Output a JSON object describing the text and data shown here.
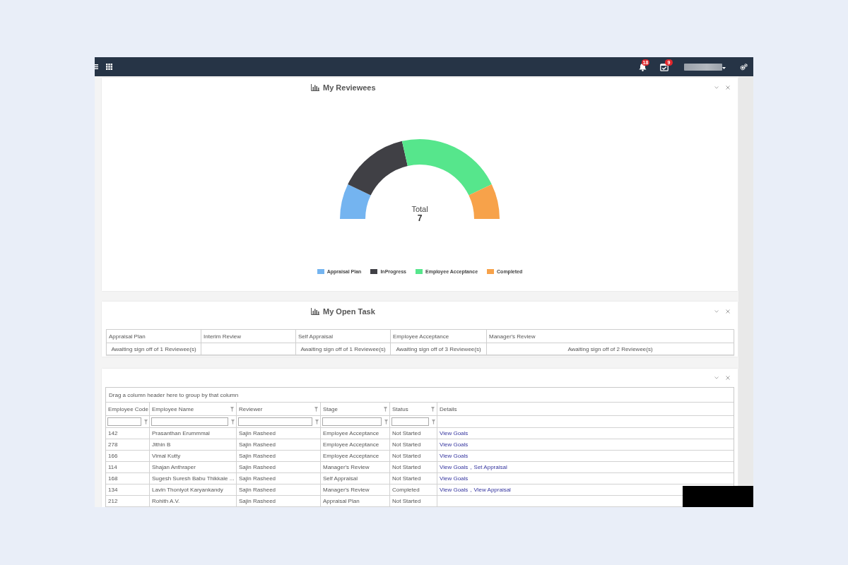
{
  "navbar": {
    "notifications": {
      "badge": "18"
    },
    "tasks": {
      "badge": "9"
    }
  },
  "reviewees": {
    "title": "My Reviewees",
    "center_label": "Total",
    "center_value": "7",
    "chart_data": {
      "type": "donut",
      "categories": [
        "Appraisal Plan",
        "InProgress",
        "Employee Acceptance",
        "Completed"
      ],
      "values": [
        14.29,
        28.57,
        42.85,
        14.29
      ],
      "colors": [
        "#74b4f0",
        "#404045",
        "#56e68c",
        "#f7a24a"
      ]
    }
  },
  "open_task": {
    "title": "My Open Task",
    "columns": [
      {
        "header": "Appraisal Plan",
        "value": "Awaiting sign off of 1 Reviewee(s)"
      },
      {
        "header": "Interim Review"
      },
      {
        "header": "Self Appraisal",
        "value": "Awaiting sign off of 1 Reviewee(s)"
      },
      {
        "header": "Employee Acceptance",
        "value": "Awaiting sign off of 3 Reviewee(s)"
      },
      {
        "header": "Manager's Review",
        "value": "Awaiting sign off of 2 Reviewee(s)"
      }
    ]
  },
  "employee_grid": {
    "group_hint": "Drag a column header here to group by that column",
    "details_separator": ",",
    "columns": [
      {
        "label": "Employee Code",
        "header_funnel": false,
        "filter_field": true
      },
      {
        "label": "Employee Name",
        "header_funnel": true,
        "filter_field": true
      },
      {
        "label": "Reviewer",
        "header_funnel": true,
        "filter_field": true
      },
      {
        "label": "Stage",
        "header_funnel": true,
        "filter_field": true
      },
      {
        "label": "Status",
        "header_funnel": true,
        "filter_field": true
      },
      {
        "label": "Details",
        "header_funnel": false,
        "filter_field": false
      }
    ],
    "rows": [
      {
        "cells": [
          "142",
          "Prasanthan Erummmal",
          "Sajin Rasheed",
          "Employee Acceptance",
          "Not Started"
        ],
        "details": [
          "View Goals"
        ]
      },
      {
        "cells": [
          "278",
          "Jithin B",
          "Sajin Rasheed",
          "Employee Acceptance",
          "Not Started"
        ],
        "details": [
          "View Goals"
        ]
      },
      {
        "cells": [
          "166",
          "Vimal Kutty",
          "Sajin Rasheed",
          "Employee Acceptance",
          "Not Started"
        ],
        "details": [
          "View Goals"
        ]
      },
      {
        "cells": [
          "114",
          "Shajan Anthraper",
          "Sajin Rasheed",
          "Manager's Review",
          "Not Started"
        ],
        "details": [
          "View Goals",
          "Set Appraisal"
        ]
      },
      {
        "cells": [
          "168",
          "Sugesh Suresh Babu Thikkale ...",
          "Sajin Rasheed",
          "Self Appraisal",
          "Not Started"
        ],
        "details": [
          "View Goals"
        ]
      },
      {
        "cells": [
          "134",
          "Lavin Thoniyot Karyankandy",
          "Sajin Rasheed",
          "Manager's Review",
          "Completed"
        ],
        "details": [
          "View Goals",
          "View Appraisal"
        ]
      },
      {
        "cells": [
          "212",
          "Rohith A.V.",
          "Sajin Rasheed",
          "Appraisal Plan",
          "Not Started"
        ]
      }
    ]
  }
}
